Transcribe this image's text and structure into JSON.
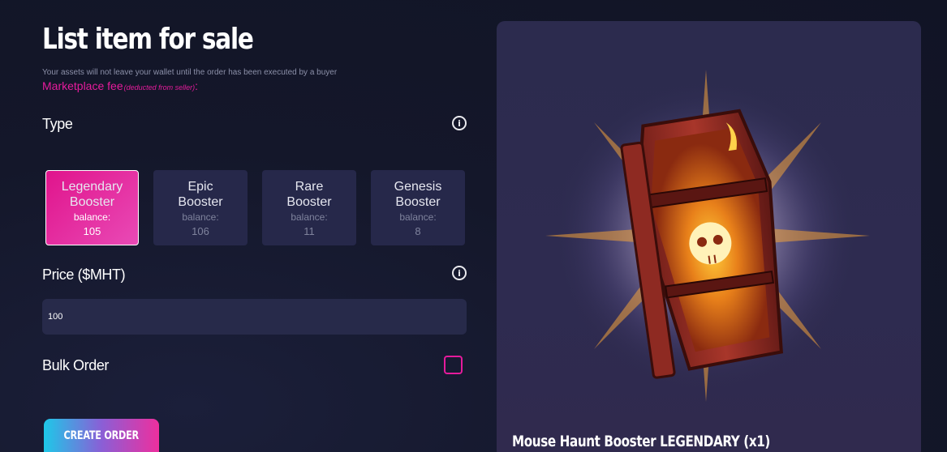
{
  "page": {
    "title": "List item for sale",
    "subtitle": "Your assets will not leave your wallet until the order has been executed by a buyer",
    "fee_label": "Marketplace fee",
    "fee_note": "(deducted from seller)",
    "fee_colon": ":"
  },
  "type_section": {
    "label": "Type",
    "info_icon": "info-icon",
    "options": [
      {
        "line1": "Legendary",
        "line2": "Booster",
        "balance_label": "balance:",
        "balance": "105",
        "selected": true
      },
      {
        "line1": "Epic",
        "line2": "Booster",
        "balance_label": "balance:",
        "balance": "106",
        "selected": false
      },
      {
        "line1": "Rare",
        "line2": "Booster",
        "balance_label": "balance:",
        "balance": "11",
        "selected": false
      },
      {
        "line1": "Genesis",
        "line2": "Booster",
        "balance_label": "balance:",
        "balance": "8",
        "selected": false
      }
    ]
  },
  "price_section": {
    "label": "Price ($MHT)",
    "info_icon": "info-icon",
    "value": "100"
  },
  "bulk_order": {
    "label": "Bulk Order",
    "checked": false
  },
  "actions": {
    "create_order": "CREATE ORDER"
  },
  "preview": {
    "item_name": "Mouse Haunt Booster LEGENDARY (x1)",
    "image": "legendary-coffin-booster"
  },
  "colors": {
    "accent": "#e51b9c",
    "background": "#14172a",
    "card": "#26284a",
    "panel": "#2c2b4e"
  }
}
